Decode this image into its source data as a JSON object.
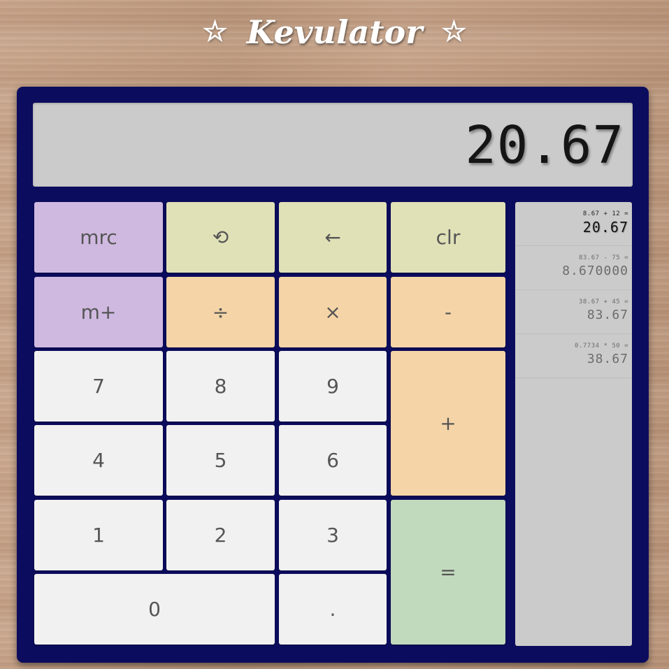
{
  "app": {
    "title": "Kevulator",
    "star": "☆"
  },
  "display": {
    "value": "20.67"
  },
  "keys": {
    "mrc": "mrc",
    "undo": "⟲",
    "backspace": "←",
    "clear": "clr",
    "m_plus": "m+",
    "divide": "÷",
    "multiply": "×",
    "subtract": "-",
    "seven": "7",
    "eight": "8",
    "nine": "9",
    "add": "+",
    "four": "4",
    "five": "5",
    "six": "6",
    "one": "1",
    "two": "2",
    "three": "3",
    "equals": "=",
    "zero": "0",
    "decimal": "."
  },
  "history": [
    {
      "expression": "8.67 + 12 =",
      "result": "20.67"
    },
    {
      "expression": "83.67 - 75 =",
      "result": "8.670000"
    },
    {
      "expression": "38.67 + 45 =",
      "result": "83.67"
    },
    {
      "expression": "0.7734 * 50 =",
      "result": "38.67"
    }
  ],
  "colors": {
    "frame": "#0c0c5e",
    "display_bg": "#cbcbcb",
    "memory_key": "#d0b9e1",
    "control_key": "#e1e1b8",
    "operator_key": "#f5d5a7",
    "digit_key": "#f1f1f1",
    "equals_key": "#c1dabd"
  }
}
